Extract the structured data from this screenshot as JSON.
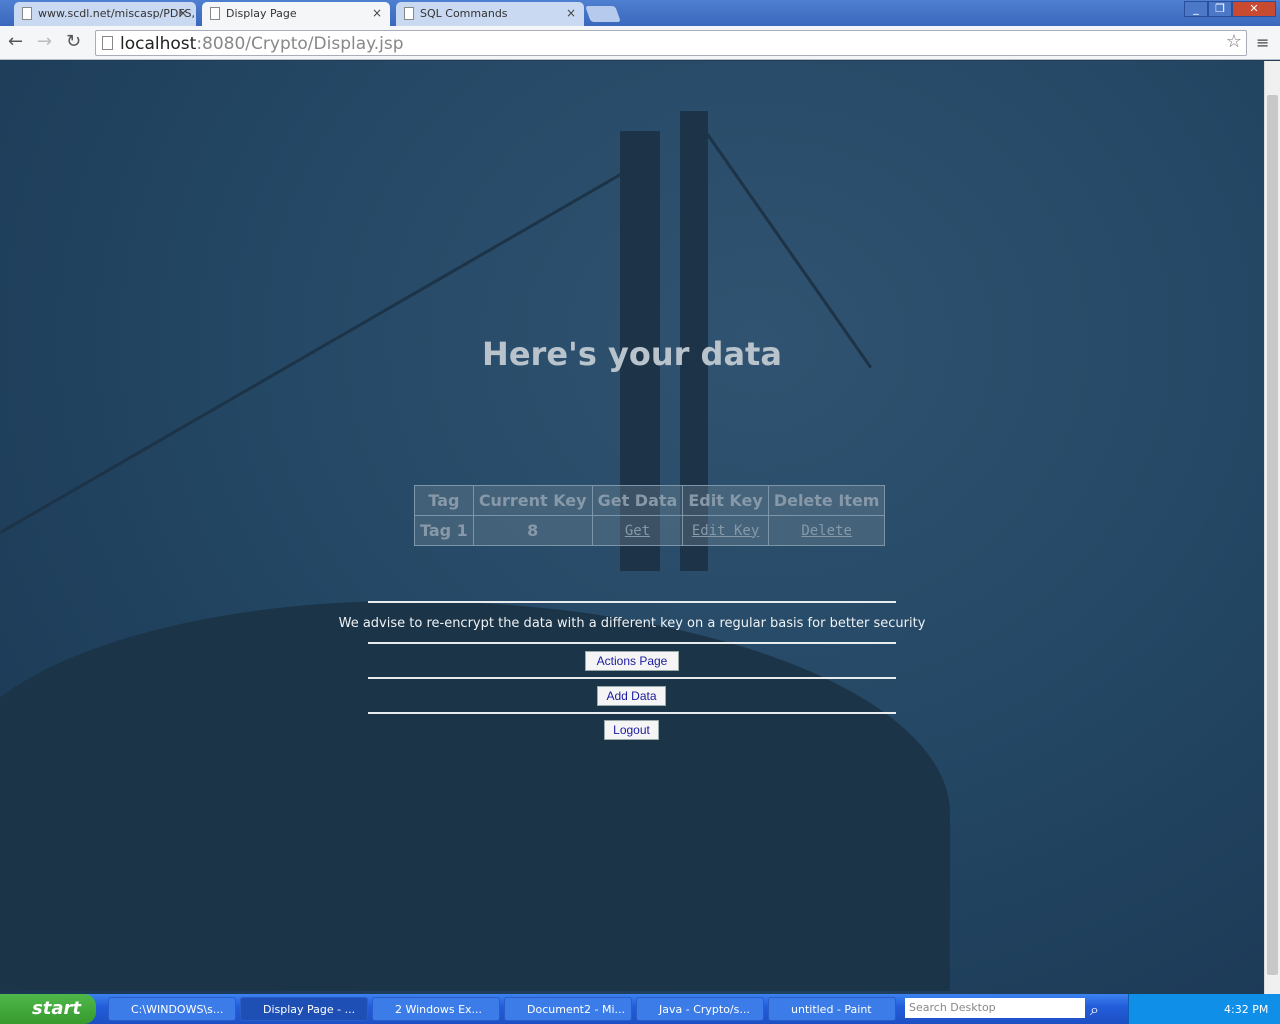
{
  "browser": {
    "tabs": [
      {
        "title": "www.scdl.net/miscasp/PDFS,"
      },
      {
        "title": "Display Page",
        "active": true
      },
      {
        "title": "SQL Commands"
      }
    ],
    "url_host": "localhost",
    "url_rest": ":8080/Crypto/Display.jsp"
  },
  "page": {
    "heading": "Here's your data",
    "table": {
      "headers": [
        "Tag",
        "Current Key",
        "Get Data",
        "Edit Key",
        "Delete Item"
      ],
      "rows": [
        {
          "tag": "Tag 1",
          "key": "8",
          "get": "Get",
          "edit": "Edit Key",
          "delete": "Delete"
        }
      ]
    },
    "advice": "We advise to re-encrypt the data with a different key on a regular basis for better security",
    "buttons": {
      "actions": "Actions Page",
      "add": "Add Data",
      "logout": "Logout"
    }
  },
  "taskbar": {
    "start": "start",
    "tasks": [
      "C:\\WINDOWS\\s...",
      "Display Page - ...",
      "2 Windows Ex...",
      "Document2 - Mi...",
      "Java - Crypto/s...",
      "untitled - Paint"
    ],
    "search_placeholder": "Search Desktop",
    "clock": "4:32 PM"
  }
}
